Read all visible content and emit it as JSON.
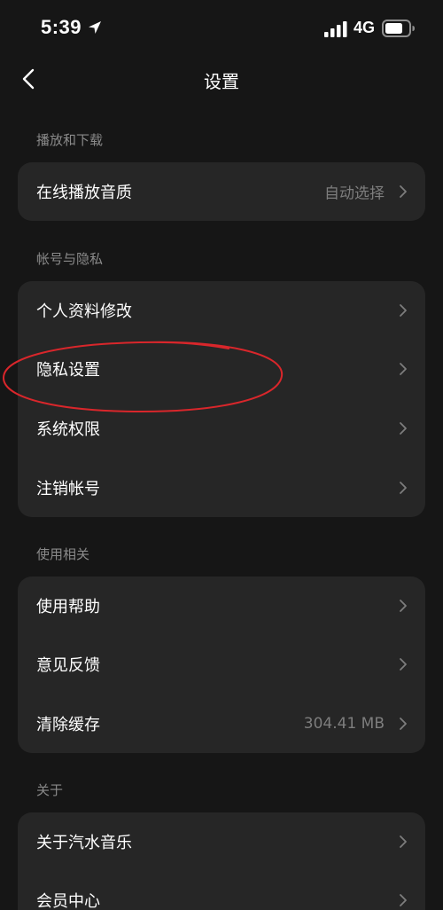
{
  "status_bar": {
    "time": "5:39",
    "network": "4G"
  },
  "nav": {
    "title": "设置"
  },
  "sections": [
    {
      "header": "播放和下载",
      "rows": [
        {
          "label": "在线播放音质",
          "value": "自动选择"
        }
      ]
    },
    {
      "header": "帐号与隐私",
      "rows": [
        {
          "label": "个人资料修改"
        },
        {
          "label": "隐私设置"
        },
        {
          "label": "系统权限"
        },
        {
          "label": "注销帐号"
        }
      ]
    },
    {
      "header": "使用相关",
      "rows": [
        {
          "label": "使用帮助"
        },
        {
          "label": "意见反馈"
        },
        {
          "label": "清除缓存",
          "value": "304.41 MB"
        }
      ]
    },
    {
      "header": "关于",
      "rows": [
        {
          "label": "关于汽水音乐"
        },
        {
          "label": "会员中心"
        }
      ]
    }
  ],
  "colors": {
    "background": "#161616",
    "card": "#262626",
    "section_header": "#8a8a8a",
    "value_text": "#7d7d7d",
    "annotation": "#d9262b"
  }
}
